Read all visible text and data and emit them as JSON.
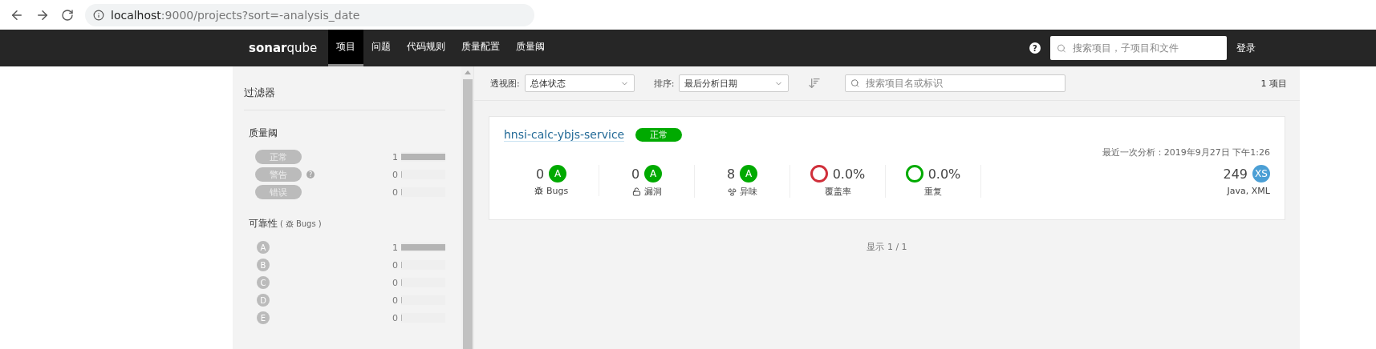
{
  "browser": {
    "url_host": "localhost",
    "url_path": ":9000/projects?sort=-analysis_date"
  },
  "nav": {
    "logo_main": "sonar",
    "logo_sub": "qube",
    "items": [
      {
        "label": "项目",
        "selected": true
      },
      {
        "label": "问题",
        "selected": false
      },
      {
        "label": "代码规则",
        "selected": false
      },
      {
        "label": "质量配置",
        "selected": false
      },
      {
        "label": "质量阈",
        "selected": false
      }
    ],
    "help": "?",
    "search": {
      "placeholder": "搜索项目，子项目和文件"
    },
    "login": "登录"
  },
  "sidebar": {
    "title": "过滤器",
    "facets": [
      {
        "title": "质量阈",
        "items": [
          {
            "kind": "pill",
            "label": "正常",
            "count": "1",
            "level": 1
          },
          {
            "kind": "pill",
            "label": "警告",
            "count": "0",
            "level": 0,
            "help_mark": "?"
          },
          {
            "kind": "pill",
            "label": "错误",
            "count": "0",
            "level": 0
          }
        ]
      },
      {
        "title": "可靠性",
        "paren_open": "(",
        "subtitle": "Bugs",
        "paren_close": ")",
        "items": [
          {
            "kind": "rating",
            "label": "A",
            "count": "1",
            "level": 1
          },
          {
            "kind": "rating",
            "label": "B",
            "count": "0",
            "level": 0
          },
          {
            "kind": "rating",
            "label": "C",
            "count": "0",
            "level": 0
          },
          {
            "kind": "rating",
            "label": "D",
            "count": "0",
            "level": 0
          },
          {
            "kind": "rating",
            "label": "E",
            "count": "0",
            "level": 0
          }
        ]
      }
    ]
  },
  "toolbar": {
    "view_label": "透视图:",
    "view_value": "总体状态",
    "sort_label": "排序:",
    "sort_value": "最后分析日期",
    "search": {
      "placeholder": "搜索项目名或标识"
    },
    "total": "1 项目"
  },
  "project": {
    "name": "hnsi-calc-ybjs-service",
    "status": "正常",
    "last_analysis": "最近一次分析：2019年9月27日 下午1:26",
    "metrics": [
      {
        "kind": "rating",
        "value": "0",
        "rating": "A",
        "label": "Bugs"
      },
      {
        "kind": "rating",
        "value": "0",
        "rating": "A",
        "label": "漏洞"
      },
      {
        "kind": "rating",
        "value": "8",
        "rating": "A",
        "label": "异味"
      },
      {
        "kind": "percent",
        "value": "0.0%",
        "color": "#d02f3a",
        "label": "覆盖率"
      },
      {
        "kind": "percent",
        "value": "0.0%",
        "color": "#00aa00",
        "label": "重复"
      }
    ],
    "size": {
      "value": "249",
      "rating": "XS",
      "languages": "Java, XML"
    }
  },
  "pagination": "显示 1 / 1"
}
